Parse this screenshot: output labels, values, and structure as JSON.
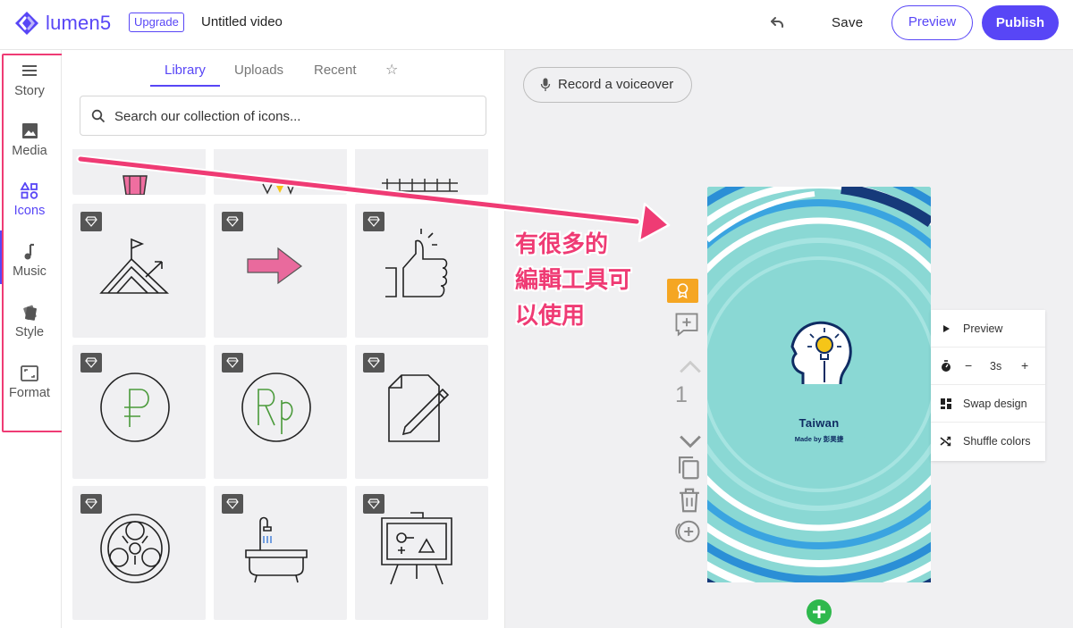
{
  "app": {
    "brand": "lumen5",
    "upgrade_label": "Upgrade",
    "title": "Untitled video",
    "save_label": "Save",
    "preview_label": "Preview",
    "publish_label": "Publish",
    "accent": "#5846f6"
  },
  "nav": {
    "items": [
      {
        "id": "story",
        "label": "Story",
        "icon": "lines-icon"
      },
      {
        "id": "media",
        "label": "Media",
        "icon": "image-icon"
      },
      {
        "id": "icons",
        "label": "Icons",
        "icon": "shapes-icon",
        "active": true
      },
      {
        "id": "music",
        "label": "Music",
        "icon": "music-note-icon"
      },
      {
        "id": "style",
        "label": "Style",
        "icon": "cards-icon"
      },
      {
        "id": "format",
        "label": "Format",
        "icon": "frame-icon"
      }
    ]
  },
  "library": {
    "tabs": [
      {
        "label": "Library",
        "active": true
      },
      {
        "label": "Uploads"
      },
      {
        "label": "Recent"
      },
      {
        "label": "☆",
        "icon": "star-icon"
      }
    ],
    "search_placeholder": "Search our collection of icons...",
    "tiles": [
      {
        "icon": "pink-cup-icon",
        "premium": false
      },
      {
        "icon": "stars-icon",
        "premium": false
      },
      {
        "icon": "fence-icon",
        "premium": false
      },
      {
        "icon": "mountain-flag-icon",
        "premium": true
      },
      {
        "icon": "pink-arrow-icon",
        "premium": true
      },
      {
        "icon": "thumbs-up-icon",
        "premium": true
      },
      {
        "icon": "ruble-coin-icon",
        "premium": true
      },
      {
        "icon": "rupiah-coin-icon",
        "premium": true
      },
      {
        "icon": "document-pencil-icon",
        "premium": true
      },
      {
        "icon": "biohazard-icon",
        "premium": true
      },
      {
        "icon": "bathtub-icon",
        "premium": true
      },
      {
        "icon": "easel-chart-icon",
        "premium": true
      }
    ]
  },
  "canvas": {
    "voiceover_label": "Record a voiceover",
    "scene_number": "1",
    "slide": {
      "title": "Taiwan",
      "subtitle": "Made by 彭昊捷",
      "background": "#8ad8d4"
    },
    "popover": {
      "preview_label": "Preview",
      "duration_minus": "−",
      "duration_value": "3s",
      "duration_plus": "+",
      "swap_label": "Swap design",
      "shuffle_label": "Shuffle colors"
    }
  },
  "annotation": {
    "line1": "有很多的",
    "line2": "編輯工具可",
    "line3": "以使用",
    "color": "#ef3b74"
  }
}
